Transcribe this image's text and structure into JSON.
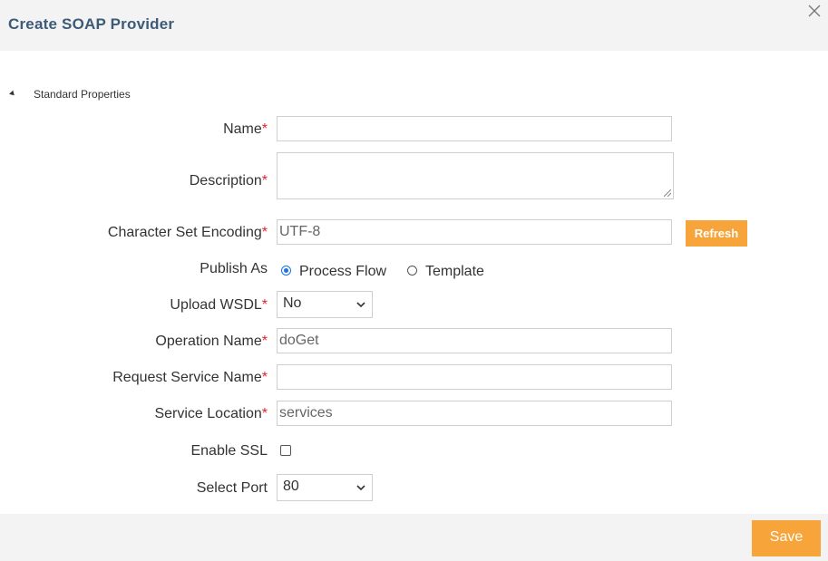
{
  "dialog": {
    "title": "Create SOAP Provider",
    "close_icon": "close-icon"
  },
  "section": {
    "title": "Standard Properties",
    "toggle_icon": "collapse-triangle-icon"
  },
  "fields": {
    "name": {
      "label": "Name",
      "required": "*",
      "value": ""
    },
    "description": {
      "label": "Description",
      "required": "*",
      "value": ""
    },
    "encoding": {
      "label": "Character Set Encoding",
      "required": "*",
      "value": "UTF-8"
    },
    "publish_as": {
      "label": "Publish As",
      "options": [
        "Process Flow",
        "Template"
      ],
      "selected": "Process Flow"
    },
    "upload_wsdl": {
      "label": "Upload WSDL",
      "required": "*",
      "value": "No"
    },
    "operation_name": {
      "label": "Operation Name",
      "required": "*",
      "value": "doGet"
    },
    "request_service_name": {
      "label": "Request Service Name",
      "required": "*",
      "value": ""
    },
    "service_location": {
      "label": "Service Location",
      "required": "*",
      "value": "services"
    },
    "enable_ssl": {
      "label": "Enable SSL",
      "checked": false
    },
    "select_port": {
      "label": "Select Port",
      "value": "80"
    }
  },
  "buttons": {
    "refresh": "Refresh",
    "save": "Save"
  },
  "colors": {
    "accent": "#f7a43a",
    "title": "#3d5a78",
    "required": "#d9262b",
    "radio_selected": "#1a73e8"
  }
}
